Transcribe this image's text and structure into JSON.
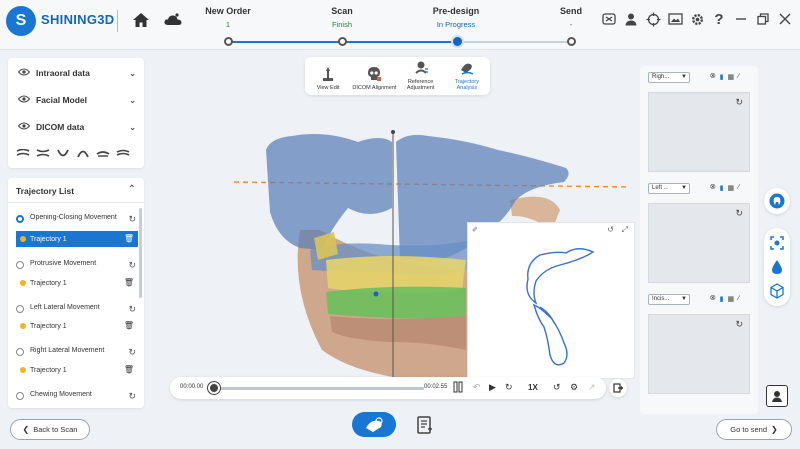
{
  "brand": {
    "name": "SHINING3D",
    "logo_letter": "S"
  },
  "steps": [
    {
      "label": "New Order",
      "status": "1",
      "status_color": "#1a8a3a"
    },
    {
      "label": "Scan",
      "status": "Finish",
      "status_color": "#1a8a3a"
    },
    {
      "label": "Pre-design",
      "status": "In Progress",
      "status_color": "#1565c0"
    },
    {
      "label": "Send",
      "status": "-",
      "status_color": "#555555"
    }
  ],
  "left_panel": {
    "items": [
      {
        "label": "Intraoral data"
      },
      {
        "label": "Facial Model"
      },
      {
        "label": "DICOM data"
      }
    ]
  },
  "trajectory_list": {
    "title": "Trajectory List",
    "movements": [
      {
        "label": "Opening-Closing Movement",
        "trajectory": "Trajectory 1"
      },
      {
        "label": "Protrusive Movement",
        "trajectory": "Trajectory 1"
      },
      {
        "label": "Left Lateral Movement",
        "trajectory": "Trajectory 1"
      },
      {
        "label": "Right Lateral Movement",
        "trajectory": "Trajectory 1"
      },
      {
        "label": "Chewing Movement",
        "trajectory": ""
      }
    ]
  },
  "toolbar": {
    "tools": [
      {
        "label": "View Edit"
      },
      {
        "label": "DICOM Alignment"
      },
      {
        "label": "Reference Adjustment"
      },
      {
        "label": "Trajectory Analysis"
      }
    ]
  },
  "playbar": {
    "current_time": "00:00.00",
    "total_time": "00:02.55",
    "speed": "1X"
  },
  "right_panel": {
    "views": [
      {
        "select": "Righ..."
      },
      {
        "select": "Left ..."
      },
      {
        "select": "Incis..."
      }
    ]
  },
  "bottom": {
    "back_label": "Back to Scan",
    "send_label": "Go to send"
  },
  "colors": {
    "accent": "#1976d2",
    "brand": "#1565c0",
    "reference_line": "#f08a2c",
    "trajectory_curve": "#3a6fd8"
  }
}
